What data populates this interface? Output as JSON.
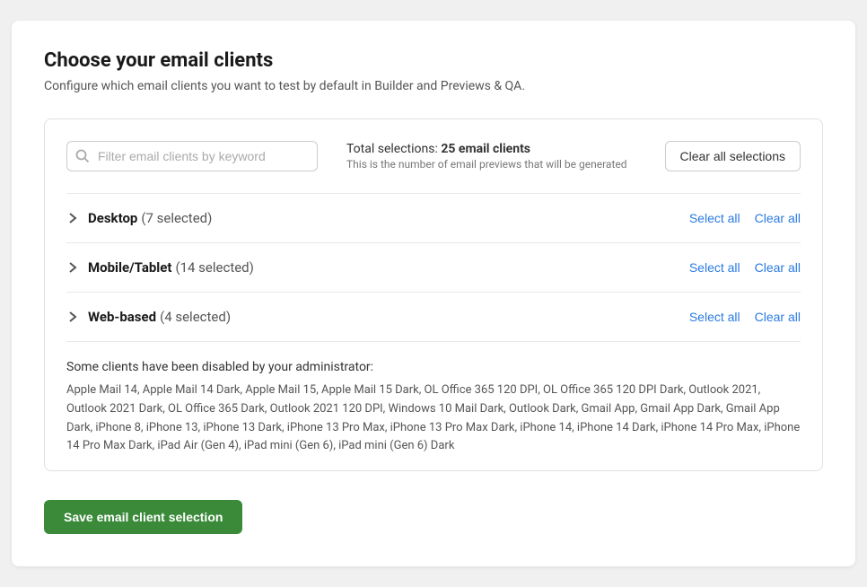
{
  "page": {
    "title": "Choose your email clients",
    "subtitle": "Configure which email clients you want to test by default in Builder and Previews & QA."
  },
  "search": {
    "placeholder": "Filter email clients by keyword"
  },
  "total_selections": {
    "label": "Total selections:",
    "count": "25 email clients",
    "sublabel": "This is the number of email previews that will be generated"
  },
  "clear_all_btn": "Clear all selections",
  "categories": [
    {
      "name": "Desktop",
      "count": "(7 selected)",
      "select_all": "Select all",
      "clear_all": "Clear all"
    },
    {
      "name": "Mobile/Tablet",
      "count": "(14 selected)",
      "select_all": "Select all",
      "clear_all": "Clear all"
    },
    {
      "name": "Web-based",
      "count": "(4 selected)",
      "select_all": "Select all",
      "clear_all": "Clear all"
    }
  ],
  "disabled_notice": {
    "title": "Some clients have been disabled by your administrator:",
    "list": "Apple Mail 14, Apple Mail 14 Dark, Apple Mail 15, Apple Mail 15 Dark, OL Office 365 120 DPI, OL Office 365 120 DPI Dark, Outlook 2021, Outlook 2021 Dark, OL Office 365 Dark, Outlook 2021 120 DPI, Windows 10 Mail Dark, Outlook Dark, Gmail App, Gmail App Dark, Gmail App Dark, iPhone 8, iPhone 13, iPhone 13 Dark, iPhone 13 Pro Max, iPhone 13 Pro Max Dark, iPhone 14, iPhone 14 Dark, iPhone 14 Pro Max, iPhone 14 Pro Max Dark, iPad Air (Gen 4), iPad mini (Gen 6), iPad mini (Gen 6) Dark"
  },
  "save_button": "Save email client selection"
}
